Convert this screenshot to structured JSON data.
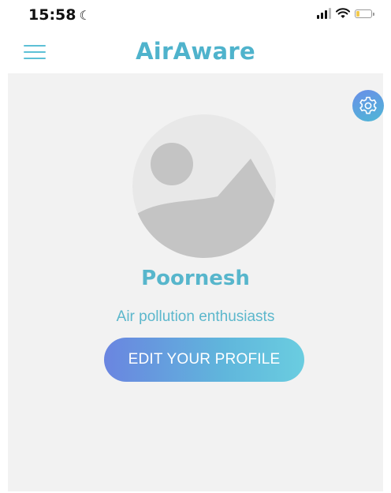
{
  "status_bar": {
    "time": "15:58",
    "battery_level": 0.25,
    "icons": [
      "moon-icon",
      "cellular-signal-icon",
      "wifi-icon",
      "battery-icon"
    ]
  },
  "header": {
    "title": "AirAware",
    "menu_icon": "hamburger-menu-icon"
  },
  "profile": {
    "name": "Poornesh",
    "bio": "Air pollution enthusiasts",
    "edit_button_label": "EDIT YOUR PROFILE",
    "settings_icon": "gear-icon",
    "avatar_icon": "image-placeholder-icon"
  },
  "colors": {
    "accent": "#4fb3cc",
    "gradient_start": "#6a85e0",
    "gradient_end": "#6acde0",
    "card_background": "#f2f2f2"
  }
}
